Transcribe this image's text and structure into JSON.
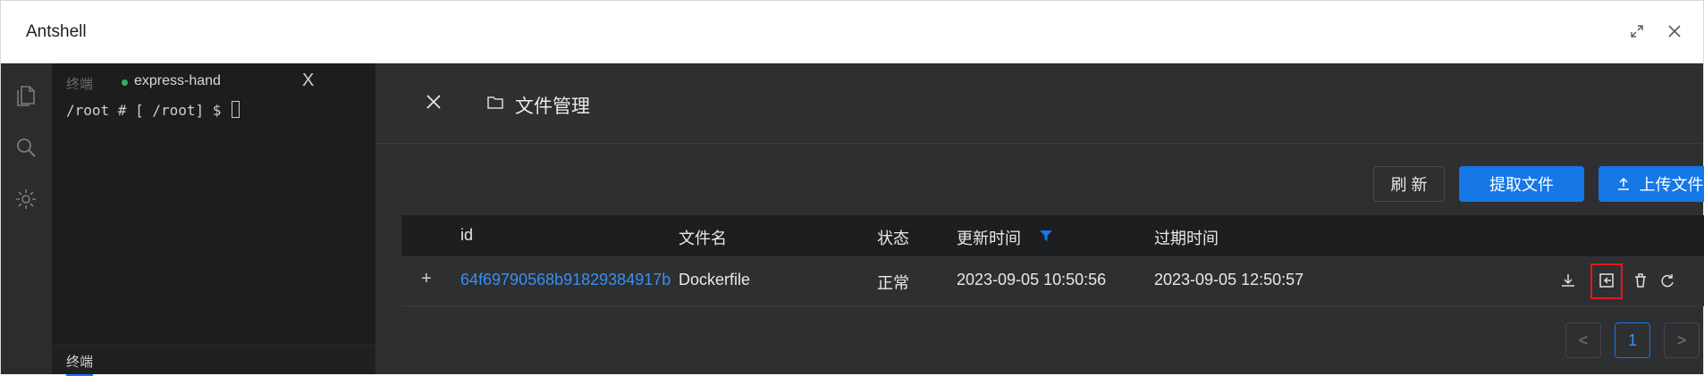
{
  "app": {
    "title": "Antshell"
  },
  "terminal": {
    "tab_inactive": "终端",
    "tab_active": "express-hand",
    "tab_close": "X",
    "prompt": "/root # [ /root] $ ",
    "bottom_tab": "终端"
  },
  "panel": {
    "close": "×",
    "title": "文件管理",
    "buttons": {
      "refresh": "刷 新",
      "extract": "提取文件",
      "upload": "上传文件"
    }
  },
  "table": {
    "columns": [
      "id",
      "文件名",
      "状态",
      "更新时间",
      "过期时间"
    ],
    "rows": [
      {
        "expand": "+",
        "id": "64f69790568b91829384917b",
        "filename": "Dockerfile",
        "status": "正常",
        "updated": "2023-09-05 10:50:56",
        "expires": "2023-09-05 12:50:57"
      }
    ]
  },
  "pagination": {
    "prev": "<",
    "current": "1",
    "next": ">"
  },
  "colors": {
    "accent": "#1677e6",
    "link": "#3b8ff0",
    "highlight": "#e21b1b",
    "status_dot": "#2db55d"
  },
  "icons": [
    "files-icon",
    "search-icon",
    "gear-icon",
    "folder-icon",
    "filter-icon",
    "download-icon",
    "share-icon",
    "delete-icon",
    "refresh-icon",
    "upload-icon",
    "maximize-icon",
    "close-icon"
  ]
}
